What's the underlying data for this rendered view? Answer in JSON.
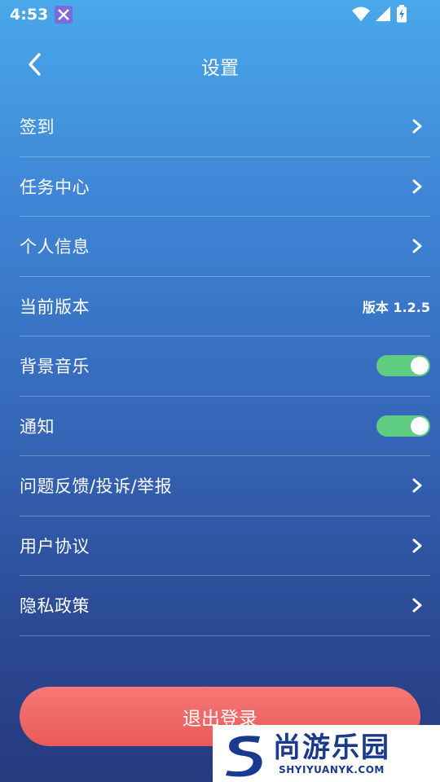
{
  "status_bar": {
    "time": "4:53",
    "icons": [
      "app-notification-icon",
      "wifi-icon",
      "cell-signal-icon",
      "battery-charging-icon"
    ]
  },
  "header": {
    "title": "设置",
    "back_icon": "chevron-left-icon"
  },
  "settings": {
    "items": [
      {
        "label": "签到",
        "trailing": "chevron"
      },
      {
        "label": "任务中心",
        "trailing": "chevron"
      },
      {
        "label": "个人信息",
        "trailing": "chevron"
      },
      {
        "label": "当前版本",
        "trailing": "text",
        "value": "版本 1.2.5"
      },
      {
        "label": "背景音乐",
        "trailing": "toggle",
        "on": true
      },
      {
        "label": "通知",
        "trailing": "toggle",
        "on": true
      },
      {
        "label": "问题反馈/投诉/举报",
        "trailing": "chevron"
      },
      {
        "label": "用户协议",
        "trailing": "chevron"
      },
      {
        "label": "隐私政策",
        "trailing": "chevron"
      }
    ]
  },
  "logout": {
    "label": "退出登录"
  },
  "watermark": {
    "name_cn": "尚游乐园",
    "name_en": "SHYIYUANYK.COM"
  },
  "colors": {
    "gradient_top": "#49a8ea",
    "gradient_bottom": "#26397e",
    "toggle_on": "#5fce82",
    "logout": "#eb5a59",
    "watermark_brand": "#1b3a8f"
  }
}
